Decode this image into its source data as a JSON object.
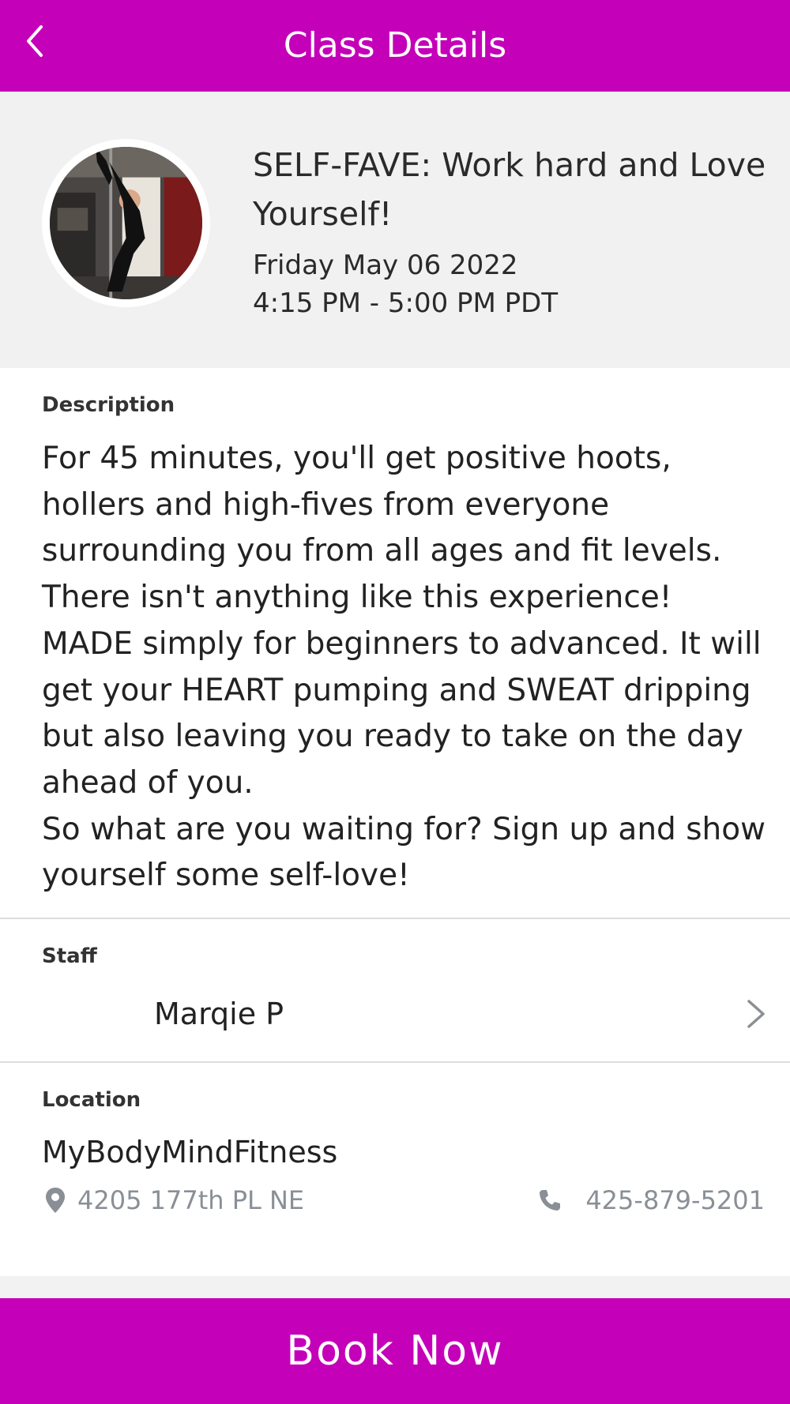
{
  "header": {
    "title": "Class Details",
    "back_icon": "chevron-left-icon"
  },
  "class": {
    "title": "SELF-FAVE: Work hard and Love Yourself!",
    "date": "Friday May 06 2022",
    "time": "4:15 PM - 5:00 PM PDT"
  },
  "description": {
    "label": "Description",
    "text": "For 45 minutes, you'll get positive hoots, hollers and high-fives from everyone surrounding you from all ages and fit levels. There isn't anything like this experience!\nMADE simply for beginners to advanced. It will get your HEART pumping and SWEAT dripping but also leaving you ready to take on the day ahead of you.\nSo what are you waiting for? Sign up and show yourself some self-love!"
  },
  "staff": {
    "label": "Staff",
    "name": "Marqie P"
  },
  "location": {
    "label": "Location",
    "name": "MyBodyMindFitness",
    "address": "4205 177th PL NE",
    "phone": "425-879-5201"
  },
  "book_button": {
    "label": "Book Now"
  },
  "colors": {
    "brand": "#c400b8",
    "muted_text": "#8a8f96",
    "header_bg": "#f1f1f1"
  }
}
